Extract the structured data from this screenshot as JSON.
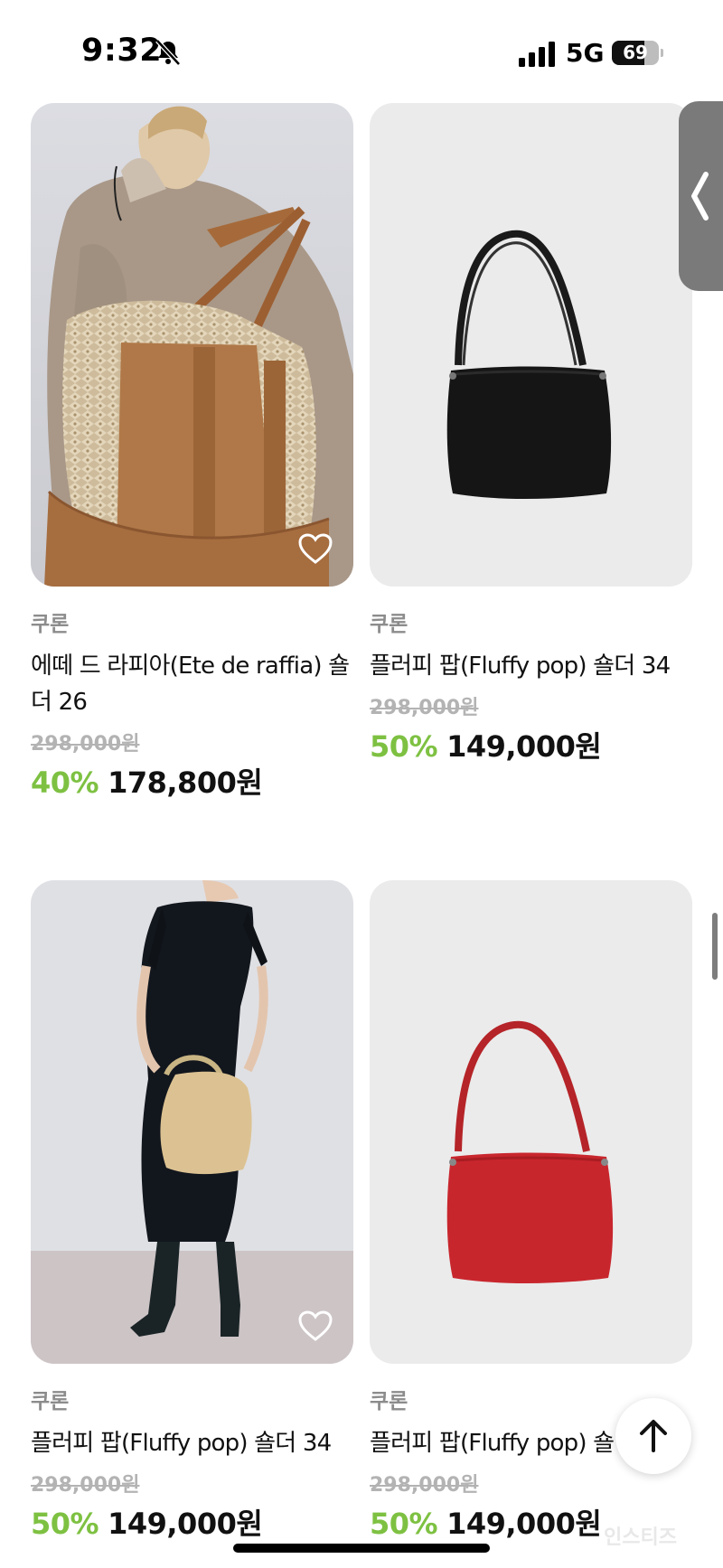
{
  "status_bar": {
    "time": "9:32",
    "network": "5G",
    "battery_level": "69",
    "battery_fraction": 0.69
  },
  "products": [
    {
      "brand": "쿠론",
      "name": "에떼 드 라피아(Ete de raffia) 숄더 26",
      "original_price": "298,000원",
      "discount": "40%",
      "sale_price": "178,800원",
      "image": "model-raffia-tote",
      "wishlisted": false
    },
    {
      "brand": "쿠론",
      "name": "플러피 팝(Fluffy pop) 숄더 34",
      "original_price": "298,000원",
      "discount": "50%",
      "sale_price": "149,000원",
      "image": "black-shoulder-bag"
    },
    {
      "brand": "쿠론",
      "name": "플러피 팝(Fluffy pop) 숄더 34",
      "original_price": "298,000원",
      "discount": "50%",
      "sale_price": "149,000원",
      "image": "model-beige-bag",
      "wishlisted": false
    },
    {
      "brand": "쿠론",
      "name": "플러피 팝(Fluffy pop) 숄",
      "original_price": "298,000원",
      "discount": "50%",
      "sale_price": "149,000원",
      "image": "red-shoulder-bag"
    }
  ],
  "watermark": "인스티즈",
  "icons": {
    "mute": "bell-slash-icon",
    "signal": "cellular-signal-icon",
    "wishlist": "heart-outline-icon",
    "drawer": "chevron-left-icon",
    "scroll_top": "arrow-up-icon"
  },
  "colors": {
    "discount": "#7ec142",
    "original_price": "#b3b3b3",
    "brand": "#8c8c8c"
  }
}
